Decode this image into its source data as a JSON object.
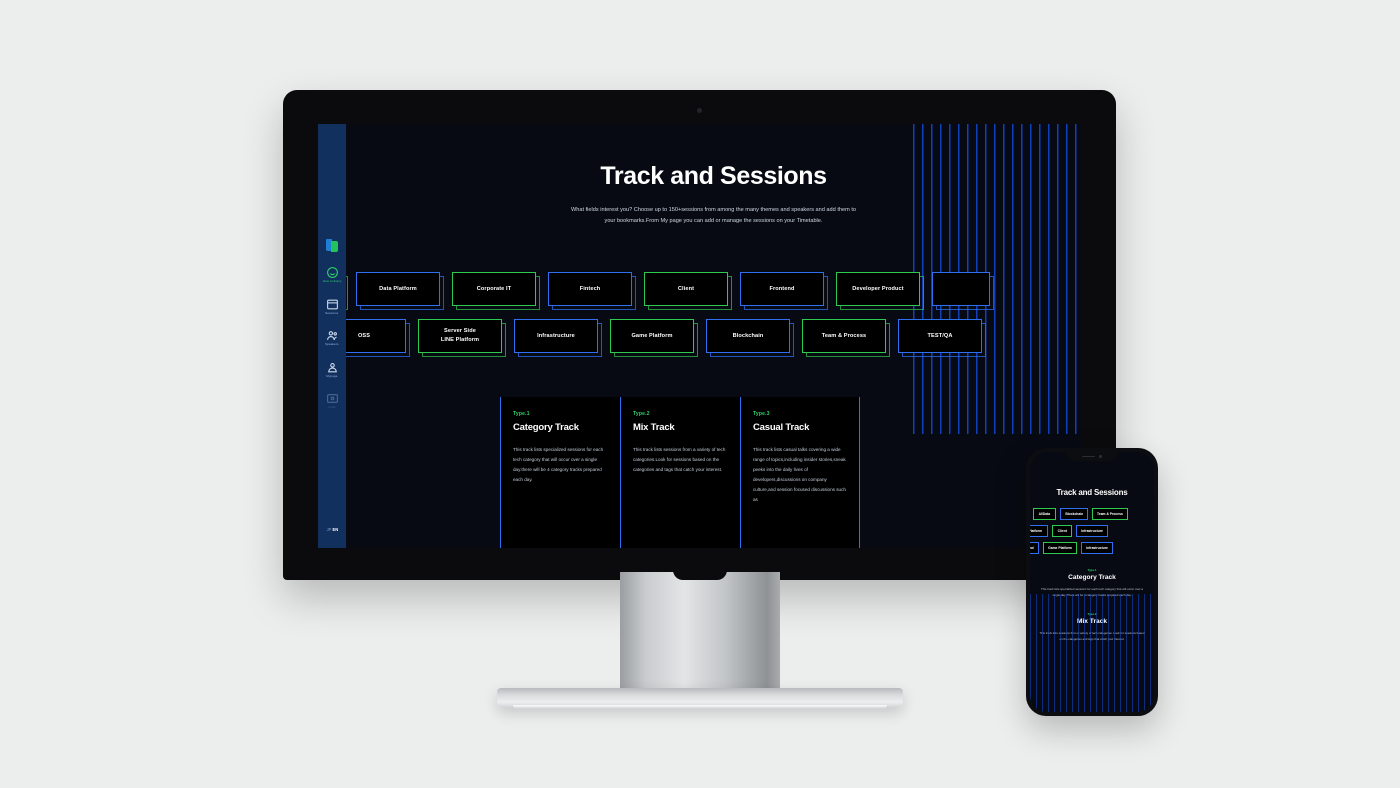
{
  "desktop": {
    "hero": {
      "title": "Track and Sessions",
      "description": "What fields interest you? Choose up to 150+sessions from among the many themes and speakers and add them to your bookmarks.From My page you can add or manage the sessions on your Timetable."
    },
    "sidebar": {
      "items": [
        {
          "label": "How to Enjoy",
          "icon": "smiley-icon",
          "state": "active"
        },
        {
          "label": "Sessions",
          "icon": "window-icon",
          "state": "normal"
        },
        {
          "label": "Speakers",
          "icon": "speakers-icon",
          "state": "normal"
        },
        {
          "label": "Mypage",
          "icon": "person-icon",
          "state": "normal"
        },
        {
          "label": "LIVE",
          "icon": "live-icon",
          "state": "dim"
        }
      ],
      "lang": {
        "jp": "JP",
        "en": "EN",
        "selected": "EN"
      }
    },
    "track_rows": [
      [
        {
          "label": "",
          "color": "green",
          "partial": true
        },
        {
          "label": "Data Platform",
          "color": "blue"
        },
        {
          "label": "Corporate IT",
          "color": "green"
        },
        {
          "label": "Fintech",
          "color": "blue"
        },
        {
          "label": "Client",
          "color": "green"
        },
        {
          "label": "Frontend",
          "color": "blue"
        },
        {
          "label": "Developer Product",
          "color": "green"
        },
        {
          "label": "",
          "color": "blue",
          "partial": true
        }
      ],
      [
        {
          "label": "OSS",
          "color": "blue"
        },
        {
          "label": "Server Side\nLINE Platform",
          "color": "green"
        },
        {
          "label": "Infrastructure",
          "color": "blue"
        },
        {
          "label": "Game Platform",
          "color": "green"
        },
        {
          "label": "Blockchain",
          "color": "blue"
        },
        {
          "label": "Team & Process",
          "color": "green"
        },
        {
          "label": "TEST/QA",
          "color": "blue"
        }
      ]
    ],
    "type_cards": [
      {
        "type": "Type.1",
        "title": "Category Track",
        "description": "This track lists specialized sessions for each tech category that will occur over a single day.there will be 4 category tracks prepared each day."
      },
      {
        "type": "Type.2",
        "title": "Mix Track",
        "description": "This track lists sessions from a variety of tech categories.Look for sessions based on the categories and tags that catch your interest."
      },
      {
        "type": "Type.3",
        "title": "Casual Track",
        "description": "This track lists casual talks covering a wide range of topics,including insider stories,sneak peeks into the daily lives of developers,discussions on company culture,and session focused discussions such as"
      }
    ]
  },
  "mobile": {
    "title": "Track and Sessions",
    "chip_rows": [
      [
        {
          "label": "AI/Data",
          "color": "green"
        },
        {
          "label": "Blockchain",
          "color": "blue"
        },
        {
          "label": "Team & Process",
          "color": "green"
        }
      ],
      [
        {
          "label": "Platform",
          "color": "blue"
        },
        {
          "label": "Client",
          "color": "green"
        },
        {
          "label": "Infrastructure",
          "color": "blue"
        }
      ],
      [
        {
          "label": "ontend",
          "color": "blue"
        },
        {
          "label": "Game Platform",
          "color": "green"
        },
        {
          "label": "Infrastructure",
          "color": "blue"
        }
      ]
    ],
    "cards": [
      {
        "type": "Type.1",
        "title": "Category Track",
        "description": "This track lists specialized sessions for each tech category that will occur over a single day. There will be 4 category tracks prepared each day."
      },
      {
        "type": "Type.2",
        "title": "Mix Track",
        "description": "This track lists sessions from a variety of tech categories. Look for sessions based on the categories and tags that catch your interest."
      }
    ]
  },
  "colors": {
    "green": "#2fc94f",
    "blue": "#2f6ff0",
    "sidebar": "#11305e",
    "screen_bg": "#070a12",
    "accent_green_text": "#2fd36a"
  }
}
